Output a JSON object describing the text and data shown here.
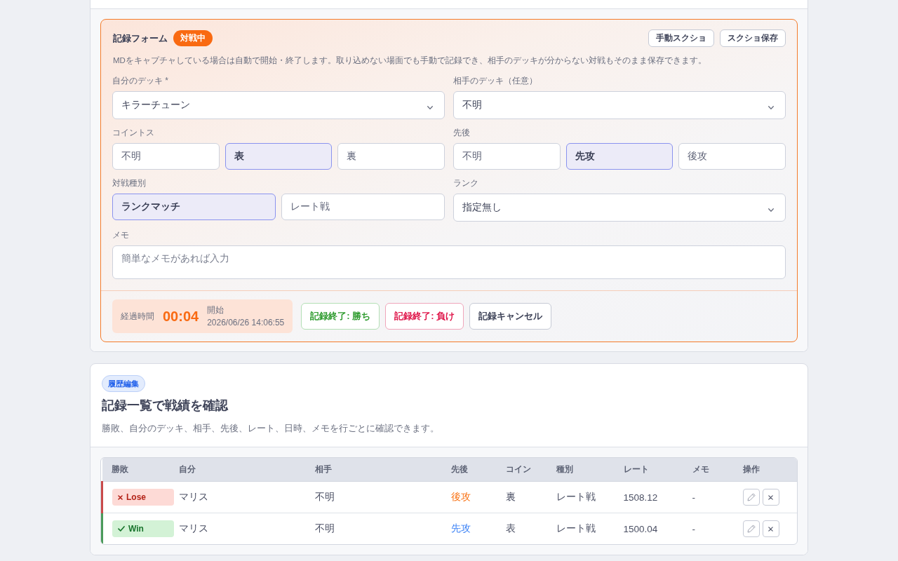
{
  "record_form": {
    "title": "記録フォーム",
    "status_badge": "対戦中",
    "buttons": [
      "手動スクショ",
      "スクショ保存"
    ],
    "description": "MDをキャプチャしている場合は自動で開始・終了します。取り込めない場面でも手動で記録でき、相手のデッキが分からない対戦もそのまま保存できます。",
    "fields": [
      {
        "kind": "select",
        "label": "自分のデッキ *",
        "value": "キラーチューン"
      },
      {
        "kind": "select",
        "label": "相手のデッキ（任意）",
        "value": "不明"
      },
      {
        "kind": "options",
        "label": "コイントス",
        "options": [
          {
            "label": "不明",
            "selected": false
          },
          {
            "label": "表",
            "selected": true
          },
          {
            "label": "裏",
            "selected": false
          }
        ]
      },
      {
        "kind": "options",
        "label": "先後",
        "options": [
          {
            "label": "不明",
            "selected": false
          },
          {
            "label": "先攻",
            "selected": true
          },
          {
            "label": "後攻",
            "selected": false
          }
        ]
      },
      {
        "kind": "options",
        "label": "対戦種別",
        "options": [
          {
            "label": "ランクマッチ",
            "selected": true
          },
          {
            "label": "レート戦",
            "selected": false
          }
        ]
      },
      {
        "kind": "select",
        "label": "ランク",
        "value": "指定無し"
      },
      {
        "kind": "textarea",
        "label": "メモ",
        "placeholder": "簡単なメモがあれば入力"
      }
    ],
    "timer": {
      "label": "経過時間",
      "elapsed": "00:04",
      "start_label": "開始",
      "start_time": "2026/06/26 14:06:55"
    },
    "actions": [
      {
        "kind": "win",
        "label": "記録終了: 勝ち"
      },
      {
        "kind": "lose",
        "label": "記録終了: 負け"
      },
      {
        "kind": "cancel",
        "label": "記録キャンセル"
      }
    ]
  },
  "history": {
    "badge": "履歴編集",
    "title": "記録一覧で戦績を確認",
    "description": "勝敗、自分のデッキ、相手、先後、レート、日時、メモを行ごとに確認できます。",
    "table": {
      "columns": [
        "勝敗",
        "自分",
        "相手",
        "先後",
        "コイン",
        "種別",
        "レート",
        "メモ",
        "操作"
      ],
      "rows": [
        {
          "result": {
            "kind": "lose",
            "label": "Lose"
          },
          "deck": "マリス",
          "opponent": "不明",
          "turn": {
            "text": "後攻",
            "color": "#f97316"
          },
          "coin": "裏",
          "match_type": "レート戦",
          "rate": "1508.12",
          "memo": "-"
        },
        {
          "result": {
            "kind": "win",
            "label": "Win"
          },
          "deck": "マリス",
          "opponent": "不明",
          "turn": {
            "text": "先攻",
            "color": "#3b82f6"
          },
          "coin": "表",
          "match_type": "レート戦",
          "rate": "1500.04",
          "memo": "-"
        }
      ]
    }
  }
}
